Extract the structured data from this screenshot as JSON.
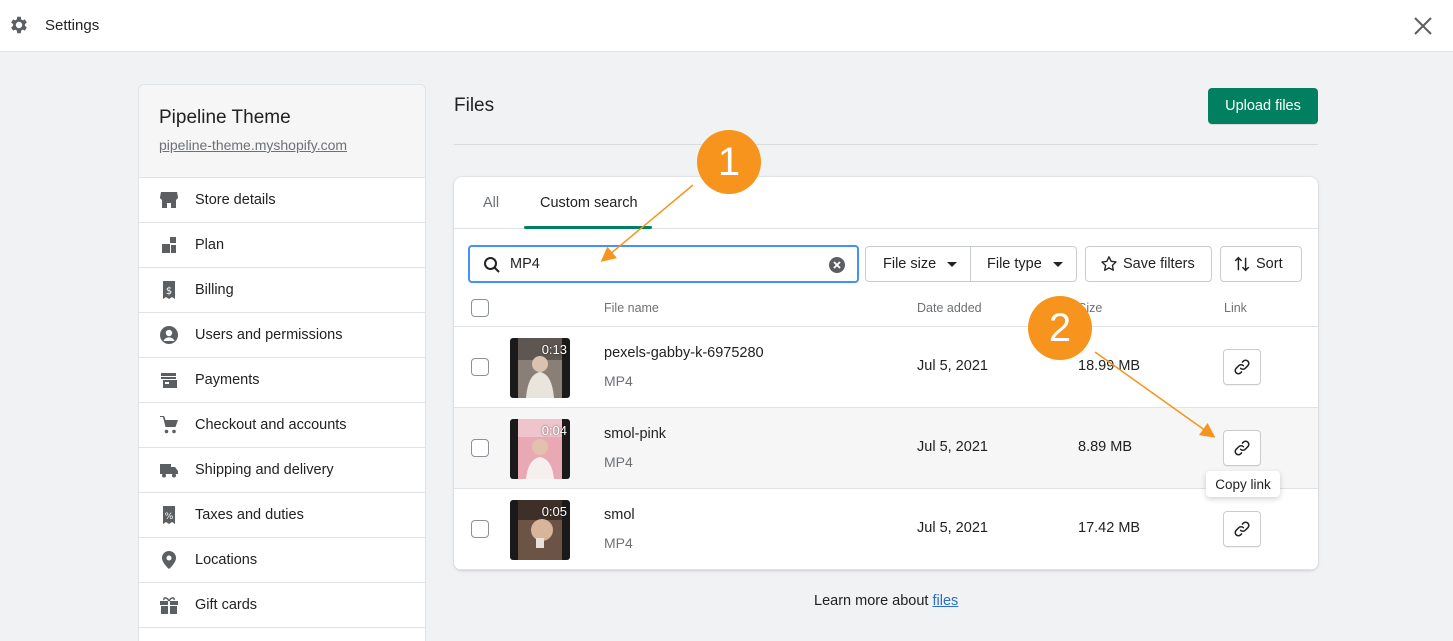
{
  "header": {
    "title": "Settings",
    "gear_icon": "gear-icon",
    "close_icon": "close-icon"
  },
  "store": {
    "name": "Pipeline Theme",
    "url": "pipeline-theme.myshopify.com"
  },
  "sidebar": {
    "items": [
      {
        "label": "Store details",
        "icon": "store-icon"
      },
      {
        "label": "Plan",
        "icon": "plan-icon"
      },
      {
        "label": "Billing",
        "icon": "billing-icon"
      },
      {
        "label": "Users and permissions",
        "icon": "user-icon"
      },
      {
        "label": "Payments",
        "icon": "payments-icon"
      },
      {
        "label": "Checkout and accounts",
        "icon": "cart-icon"
      },
      {
        "label": "Shipping and delivery",
        "icon": "truck-icon"
      },
      {
        "label": "Taxes and duties",
        "icon": "tax-icon"
      },
      {
        "label": "Locations",
        "icon": "location-pin-icon"
      },
      {
        "label": "Gift cards",
        "icon": "gift-icon"
      }
    ]
  },
  "main": {
    "title": "Files",
    "upload_label": "Upload files",
    "tabs": [
      {
        "label": "All"
      },
      {
        "label": "Custom search",
        "selected": true
      }
    ],
    "search": {
      "value": "MP4"
    },
    "filters": {
      "file_size": "File size",
      "file_type": "File type",
      "save": "Save filters",
      "sort": "Sort"
    },
    "columns": {
      "name": "File name",
      "date": "Date added",
      "size": "Size",
      "link": "Link"
    },
    "rows": [
      {
        "name": "pexels-gabby-k-6975280",
        "type": "MP4",
        "date": "Jul 5, 2021",
        "size": "18.99 MB",
        "duration": "0:13"
      },
      {
        "name": "smol-pink",
        "type": "MP4",
        "date": "Jul 5, 2021",
        "size": "8.89 MB",
        "duration": "0:04"
      },
      {
        "name": "smol",
        "type": "MP4",
        "date": "Jul 5, 2021",
        "size": "17.42 MB",
        "duration": "0:05"
      }
    ],
    "tooltip": "Copy link",
    "learn_more": {
      "prefix": "Learn more about ",
      "link": "files"
    }
  },
  "annotations": {
    "step1": "1",
    "step2": "2",
    "color": "#f7941d"
  },
  "colors": {
    "primary": "#008060",
    "focus": "#458fff",
    "link": "#2c6ecb"
  }
}
